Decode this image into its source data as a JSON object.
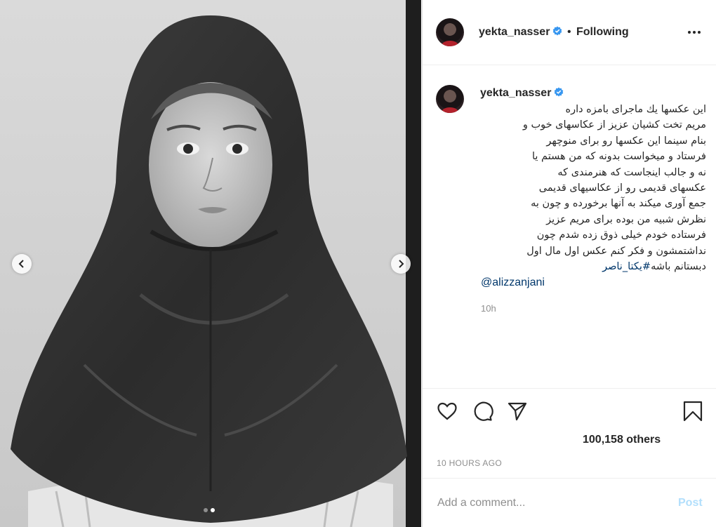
{
  "header": {
    "username": "yekta_nasser",
    "separator": "•",
    "follow_status": "Following"
  },
  "caption": {
    "username": "yekta_nasser",
    "lines": [
      "این عکسها یك ماجرای بامزه داره",
      "مریم تخت کشیان عزیز از عکاسهای خوب و",
      "بنام سینما این عکسها رو برای منوچهر",
      "فرستاد و میخواست بدونه که من هستم یا",
      "نه و جالب اینجاست که هنرمندی که",
      "عکسهای قدیمی رو از عکاسیهای قدیمی",
      "جمع آوری میکند به آنها برخورده و چون به",
      "نظرش شبیه من بوده برای مریم عزیز",
      "فرستاده خودم خیلی ذوق زده شدم چون",
      "نداشتمشون و فکر کنم عکس اول مال اول"
    ],
    "last_line_text": "دبستانم باشه",
    "hashtag": "#یکتا_ناصر",
    "mention": "@alizzanjani",
    "time": "10h"
  },
  "actions": {
    "likes": "100,158 others",
    "time_ago": "10 HOURS AGO"
  },
  "comment": {
    "placeholder": "Add a comment...",
    "post_label": "Post"
  },
  "carousel": {
    "slide_count": 2,
    "active_slide": 2
  },
  "icons": {
    "verified": "verified-badge-icon",
    "more": "more-options-icon",
    "like": "heart-icon",
    "comment": "comment-bubble-icon",
    "share": "paper-plane-icon",
    "save": "bookmark-icon",
    "prev": "chevron-left-icon",
    "next": "chevron-right-icon"
  },
  "colors": {
    "verified_blue": "#3897f0",
    "link_blue": "#00376b",
    "post_disabled": "#b2dffc",
    "muted": "#8e8e8e",
    "text": "#262626"
  }
}
